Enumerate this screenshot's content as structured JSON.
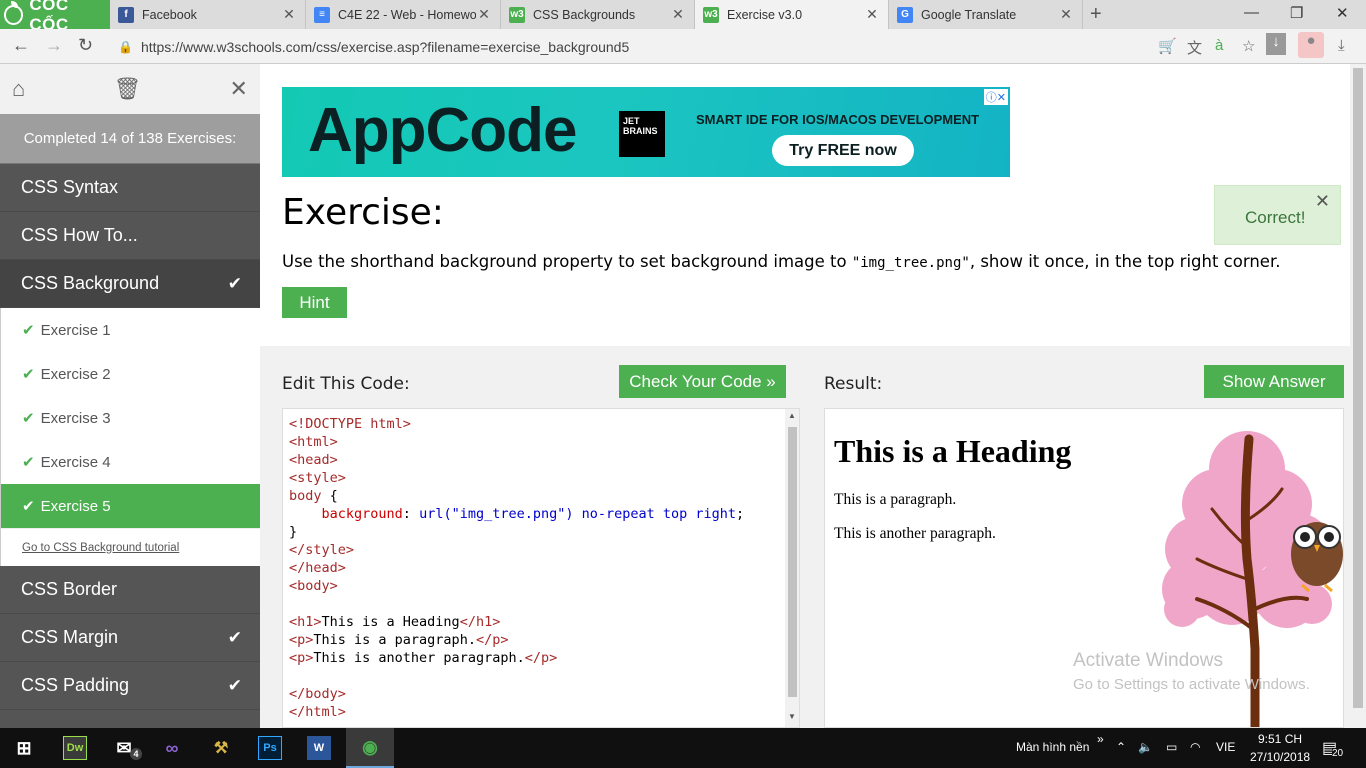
{
  "browser": {
    "brand_label": "CỐC CỐC",
    "tabs": [
      {
        "label": "Facebook",
        "icon": "facebook-icon"
      },
      {
        "label": "C4E 22 - Web - Homewo",
        "icon": "google-docs-icon"
      },
      {
        "label": "CSS Backgrounds",
        "icon": "w3schools-icon"
      },
      {
        "label": "Exercise v3.0",
        "icon": "w3schools-icon"
      },
      {
        "label": "Google Translate",
        "icon": "google-translate-icon"
      }
    ],
    "url": "https://www.w3schools.com/css/exercise.asp?filename=exercise_background5"
  },
  "sidebar": {
    "progress": "Completed 14 of 138 Exercises:",
    "categories_before": [
      {
        "label": "CSS Syntax",
        "done": false
      },
      {
        "label": "CSS How To...",
        "done": false
      }
    ],
    "current_category": {
      "label": "CSS Background",
      "done": true
    },
    "exercises": [
      "Exercise 1",
      "Exercise 2",
      "Exercise 3",
      "Exercise 4",
      "Exercise 5"
    ],
    "tutorial_link": "Go to CSS Background tutorial",
    "categories_after": [
      {
        "label": "CSS Border",
        "done": false
      },
      {
        "label": "CSS Margin",
        "done": true
      },
      {
        "label": "CSS Padding",
        "done": true
      }
    ]
  },
  "ad": {
    "product": "AppCode",
    "company": "JET BRAINS",
    "tagline": "SMART IDE FOR IOS/MACOS DEVELOPMENT",
    "cta": "Try FREE now"
  },
  "exercise": {
    "title": "Exercise:",
    "instruction_pre": "Use the shorthand background property to set background image to ",
    "instruction_code": "\"img_tree.png\"",
    "instruction_post": ", show it once, in the top right corner.",
    "hint_label": "Hint",
    "correct_label": "Correct!"
  },
  "editor": {
    "label": "Edit This Code:",
    "check_label": "Check Your Code »"
  },
  "result": {
    "label": "Result:",
    "show_answer_label": "Show Answer",
    "heading": "This is a Heading",
    "paragraph1": "This is a paragraph.",
    "paragraph2": "This is another paragraph."
  },
  "windows_watermark": {
    "line1": "Activate Windows",
    "line2": "Go to Settings to activate Windows."
  },
  "taskbar": {
    "desktop_label": "Màn hình nền",
    "language": "VIE",
    "time": "9:51 CH",
    "date": "27/10/2018",
    "notification_count": "20",
    "mail_badge": "4"
  },
  "colors": {
    "w3_green": "#4caf50",
    "sidebar_dark": "#555555",
    "correct_bg": "#dff0d8"
  }
}
